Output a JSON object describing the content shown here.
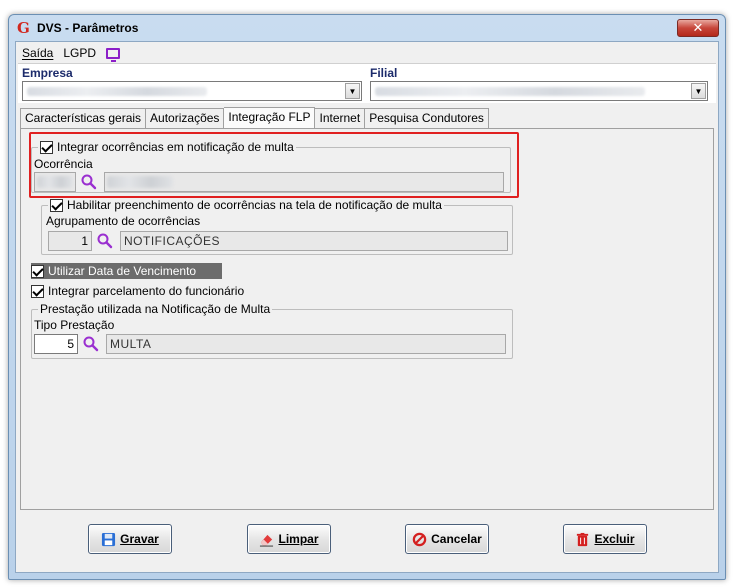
{
  "window": {
    "title": "DVS - Parâmetros",
    "close_glyph": "✕"
  },
  "menu": [
    {
      "label": "Saída",
      "accel": "S"
    },
    {
      "label": "LGPD",
      "accel": "L"
    }
  ],
  "header": {
    "empresa_label": "Empresa",
    "filial_label": "Filial"
  },
  "tabs": [
    {
      "label": "Características gerais",
      "active": false
    },
    {
      "label": "Autorizações",
      "active": false
    },
    {
      "label": "Integração FLP",
      "active": true
    },
    {
      "label": "Internet",
      "active": false
    },
    {
      "label": "Pesquisa Condutores",
      "active": false
    }
  ],
  "integrar_ocorrencias": {
    "checkbox_label": "Integrar ocorrências em notificação de multa",
    "checked": true,
    "field_label": "Ocorrência"
  },
  "habilitar_preenchimento": {
    "checkbox_label": "Habilitar preenchimento de ocorrências na tela de notificação de multa",
    "checked": true,
    "field_label": "Agrupamento de ocorrências",
    "code": "1",
    "description": "NOTIFICAÇÕES"
  },
  "utilizar_data_vencimento": {
    "label": "Utilizar Data de Vencimento",
    "checked": true
  },
  "integrar_parcelamento": {
    "label": "Integrar parcelamento do funcionário",
    "checked": true
  },
  "prestacao": {
    "legend": "Prestação utilizada na Notificação de Multa",
    "field_label": "Tipo Prestação",
    "code": "5",
    "description": "MULTA"
  },
  "buttons": {
    "gravar": {
      "label": "Gravar",
      "icon": "floppy-disk-icon"
    },
    "limpar": {
      "label": "Limpar",
      "icon": "eraser-icon"
    },
    "cancelar": {
      "label": "Cancelar",
      "icon": "cancel-circle-icon"
    },
    "excluir": {
      "label": "Excluir",
      "icon": "trash-icon"
    }
  },
  "colors": {
    "highlight": "#e02020",
    "accent_icon": "#8c1fc8",
    "label_blue": "#1c2b6b"
  }
}
